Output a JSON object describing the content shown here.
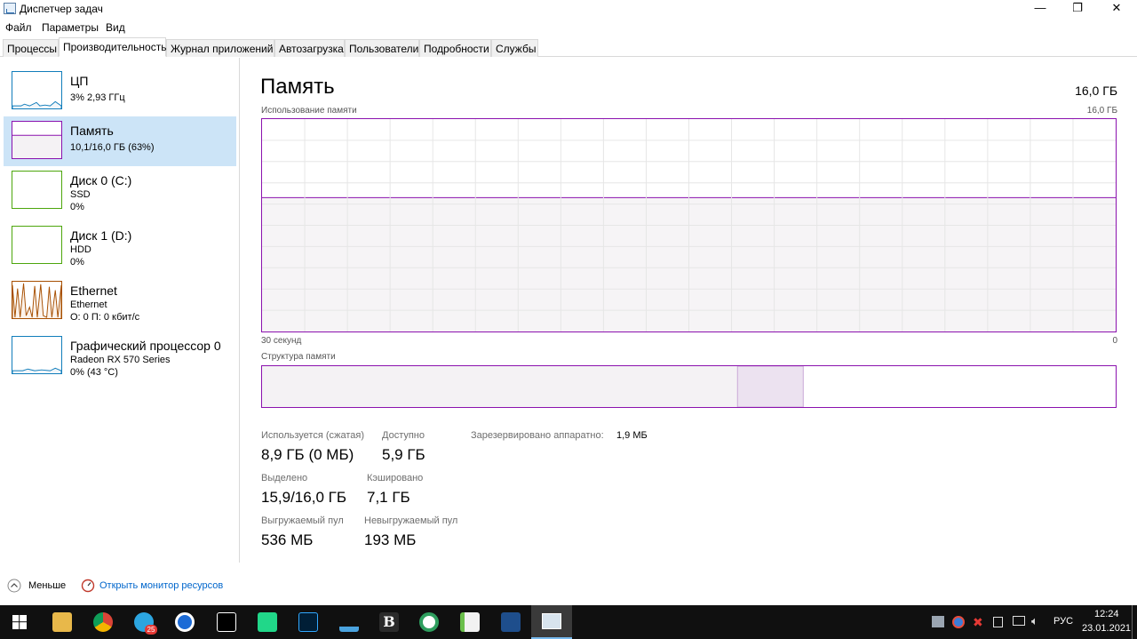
{
  "window": {
    "title": "Диспетчер задач",
    "minimize_glyph": "—",
    "restore_glyph": "❐",
    "close_glyph": "✕"
  },
  "menu": [
    "Файл",
    "Параметры",
    "Вид"
  ],
  "tabs": [
    "Процессы",
    "Производительность",
    "Журнал приложений",
    "Автозагрузка",
    "Пользователи",
    "Подробности",
    "Службы"
  ],
  "sidebar": {
    "items": [
      {
        "title": "ЦП",
        "sub1": "3% 2,93 ГГц",
        "sub2": "",
        "color": "#117dbb"
      },
      {
        "title": "Память",
        "sub1": "10,1/16,0 ГБ (63%)",
        "sub2": "",
        "color": "#8b12ae"
      },
      {
        "title": "Диск 0 (C:)",
        "sub1": "SSD",
        "sub2": "0%",
        "color": "#4da60c"
      },
      {
        "title": "Диск 1 (D:)",
        "sub1": "HDD",
        "sub2": "0%",
        "color": "#4da60c"
      },
      {
        "title": "Ethernet",
        "sub1": "Ethernet",
        "sub2": "О: 0 П: 0 кбит/с",
        "color": "#a74f01"
      },
      {
        "title": "Графический процессор 0",
        "sub1": "Radeon RX 570 Series",
        "sub2": "0% (43 °C)",
        "color": "#117dbb"
      }
    ]
  },
  "main": {
    "title": "Память",
    "total": "16,0 ГБ",
    "graph_label": "Использование памяти",
    "graph_max": "16,0 ГБ",
    "time_label": "30 секунд",
    "time_zero": "0",
    "usage_fraction": 0.63,
    "struct_label": "Структура памяти",
    "struct_in_use_fraction": 0.557,
    "struct_modified_fraction": 0.077
  },
  "stats": {
    "in_use_label": "Используется (сжатая)",
    "in_use_value": "8,9 ГБ (0 МБ)",
    "available_label": "Доступно",
    "available_value": "5,9 ГБ",
    "reserved_label": "Зарезервировано аппаратно:",
    "reserved_value": "1,9 МБ",
    "committed_label": "Выделено",
    "committed_value": "15,9/16,0 ГБ",
    "cached_label": "Кэшировано",
    "cached_value": "7,1 ГБ",
    "paged_label": "Выгружаемый пул",
    "paged_value": "536 МБ",
    "nonpaged_label": "Невыгружаемый пул",
    "nonpaged_value": "193 МБ"
  },
  "footer": {
    "less_label": "Меньше",
    "monitor_label": "Открыть монитор ресурсов",
    "link_color": "#0066cc"
  },
  "taskbar": {
    "telegram_badge": "25",
    "lang": "РУС",
    "time": "12:24",
    "date": "23.01.2021"
  }
}
